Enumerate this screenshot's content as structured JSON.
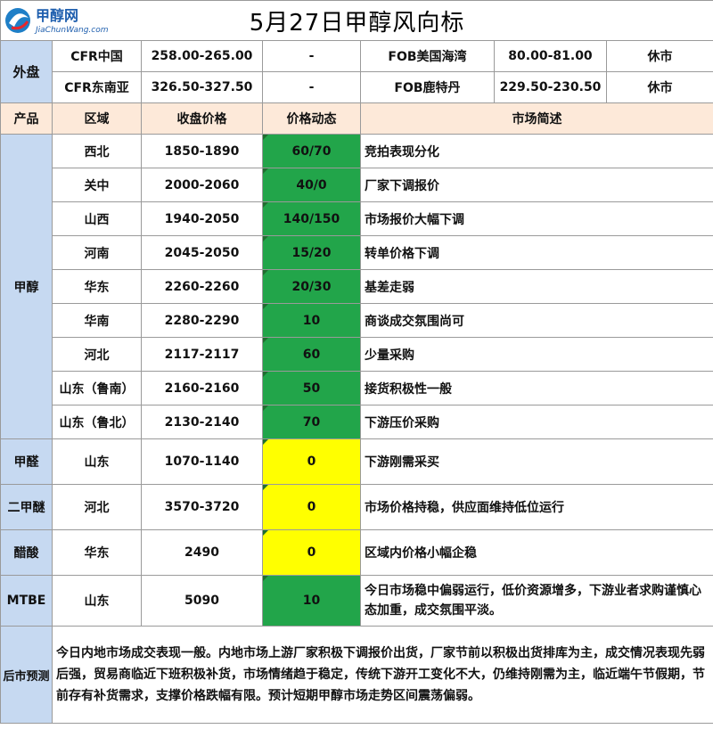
{
  "header": {
    "logo_cn": "甲醇网",
    "logo_url_text": "JiaChunWang.com",
    "title": "5月27日甲醇风向标"
  },
  "external": {
    "label": "外盘",
    "rows": [
      {
        "name1": "CFR中国",
        "price1": "258.00-265.00",
        "change1": "-",
        "name2": "FOB美国海湾",
        "price2": "80.00-81.00",
        "status": "休市"
      },
      {
        "name1": "CFR东南亚",
        "price1": "326.50-327.50",
        "change1": "-",
        "name2": "FOB鹿特丹",
        "price2": "229.50-230.50",
        "status": "休市"
      }
    ]
  },
  "columns": {
    "product": "产品",
    "region": "区域",
    "close_price": "收盘价格",
    "price_change": "价格动态",
    "market_desc": "市场简述"
  },
  "products": [
    {
      "name": "甲醇",
      "rows": [
        {
          "region": "西北",
          "price": "1850-1890",
          "change": "60/70",
          "color": "#22a54a",
          "desc": "竞拍表现分化"
        },
        {
          "region": "关中",
          "price": "2000-2060",
          "change": "40/0",
          "color": "#22a54a",
          "desc": "厂家下调报价"
        },
        {
          "region": "山西",
          "price": "1940-2050",
          "change": "140/150",
          "color": "#22a54a",
          "desc": "市场报价大幅下调"
        },
        {
          "region": "河南",
          "price": "2045-2050",
          "change": "15/20",
          "color": "#22a54a",
          "desc": "转单价格下调"
        },
        {
          "region": "华东",
          "price": "2260-2260",
          "change": "20/30",
          "color": "#22a54a",
          "desc": "基差走弱"
        },
        {
          "region": "华南",
          "price": "2280-2290",
          "change": "10",
          "color": "#22a54a",
          "desc": "商谈成交氛围尚可"
        },
        {
          "region": "河北",
          "price": "2117-2117",
          "change": "60",
          "color": "#22a54a",
          "desc": "少量采购"
        },
        {
          "region": "山东（鲁南）",
          "price": "2160-2160",
          "change": "50",
          "color": "#22a54a",
          "desc": "接货积极性一般"
        },
        {
          "region": "山东（鲁北）",
          "price": "2130-2140",
          "change": "70",
          "color": "#22a54a",
          "desc": "下游压价采购"
        }
      ]
    },
    {
      "name": "甲醛",
      "rows": [
        {
          "region": "山东",
          "price": "1070-1140",
          "change": "0",
          "color": "#ffff00",
          "desc": "下游刚需采买"
        }
      ]
    },
    {
      "name": "二甲醚",
      "rows": [
        {
          "region": "河北",
          "price": "3570-3720",
          "change": "0",
          "color": "#ffff00",
          "desc": "市场价格持稳，供应面维持低位运行"
        }
      ]
    },
    {
      "name": "醋酸",
      "rows": [
        {
          "region": "华东",
          "price": "2490",
          "change": "0",
          "color": "#ffff00",
          "desc": "区域内价格小幅企稳"
        }
      ]
    },
    {
      "name": "MTBE",
      "rows": [
        {
          "region": "山东",
          "price": "5090",
          "change": "10",
          "color": "#22a54a",
          "desc": "今日市场稳中偏弱运行，低价资源增多，下游业者求购谨慎心态加重，成交氛围平淡。"
        }
      ]
    }
  ],
  "forecast": {
    "label": "后市预测",
    "text": "今日内地市场成交表现一般。内地市场上游厂家积极下调报价出货，厂家节前以积极出货排库为主，成交情况表现先弱后强，贸易商临近下班积极补货，市场情绪趋于稳定，传统下游开工变化不大，仍维持刚需为主，临近端午节假期，节前存有补货需求，支撑价格跌幅有限。预计短期甲醇市场走势区间震荡偏弱。"
  }
}
